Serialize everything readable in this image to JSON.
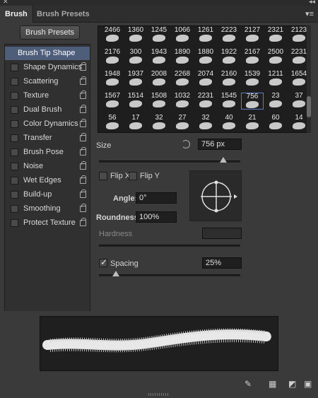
{
  "window": {
    "close_glyph": "✕",
    "collapse_glyph": "◂◂",
    "menu_glyph": "▾≡"
  },
  "tabs": [
    {
      "label": "Brush",
      "active": true
    },
    {
      "label": "Brush Presets",
      "active": false
    }
  ],
  "left": {
    "presets_button": "Brush Presets",
    "items": [
      {
        "label": "Brush Tip Shape",
        "selected": true,
        "checkbox": false,
        "lock": false
      },
      {
        "label": "Shape Dynamics",
        "checkbox": true,
        "lock": true
      },
      {
        "label": "Scattering",
        "checkbox": true,
        "lock": true
      },
      {
        "label": "Texture",
        "checkbox": true,
        "lock": true
      },
      {
        "label": "Dual Brush",
        "checkbox": true,
        "lock": true
      },
      {
        "label": "Color Dynamics",
        "checkbox": true,
        "lock": true
      },
      {
        "label": "Transfer",
        "checkbox": true,
        "lock": true
      },
      {
        "label": "Brush Pose",
        "checkbox": true,
        "lock": true
      },
      {
        "label": "Noise",
        "checkbox": true,
        "lock": true
      },
      {
        "label": "Wet Edges",
        "checkbox": true,
        "lock": true
      },
      {
        "label": "Build-up",
        "checkbox": true,
        "lock": true
      },
      {
        "label": "Smoothing",
        "checkbox": true,
        "lock": true
      },
      {
        "label": "Protect Texture",
        "checkbox": true,
        "lock": true
      }
    ]
  },
  "brushes": [
    [
      "2466",
      "1360",
      "1245",
      "1066",
      "1261",
      "2223",
      "2127",
      "2321",
      "2123"
    ],
    [
      "2176",
      "300",
      "1943",
      "1890",
      "1880",
      "1922",
      "2167",
      "2500",
      "2231"
    ],
    [
      "1948",
      "1937",
      "2008",
      "2268",
      "2074",
      "2160",
      "1539",
      "1211",
      "1654"
    ],
    [
      "1567",
      "1514",
      "1508",
      "1032",
      "2231",
      "1545",
      "756",
      "23",
      "37"
    ],
    [
      "56",
      "17",
      "32",
      "27",
      "32",
      "40",
      "21",
      "60",
      "14"
    ]
  ],
  "selected_brush": {
    "row": 3,
    "col": 6
  },
  "size": {
    "label": "Size",
    "value": "756 px",
    "slider_fraction": 0.88
  },
  "flip_x": {
    "label": "Flip X",
    "checked": false
  },
  "flip_y": {
    "label": "Flip Y",
    "checked": false
  },
  "angle": {
    "label": "Angle:",
    "value": "0°"
  },
  "roundness": {
    "label": "Roundness:",
    "value": "100%"
  },
  "hardness": {
    "label": "Hardness",
    "value": ""
  },
  "spacing": {
    "label": "Spacing",
    "checked": true,
    "value": "25%",
    "slider_fraction": 0.12
  },
  "bottom_icons": [
    "brush-pressure-icon",
    "grid-icon",
    "new-preset-icon"
  ]
}
